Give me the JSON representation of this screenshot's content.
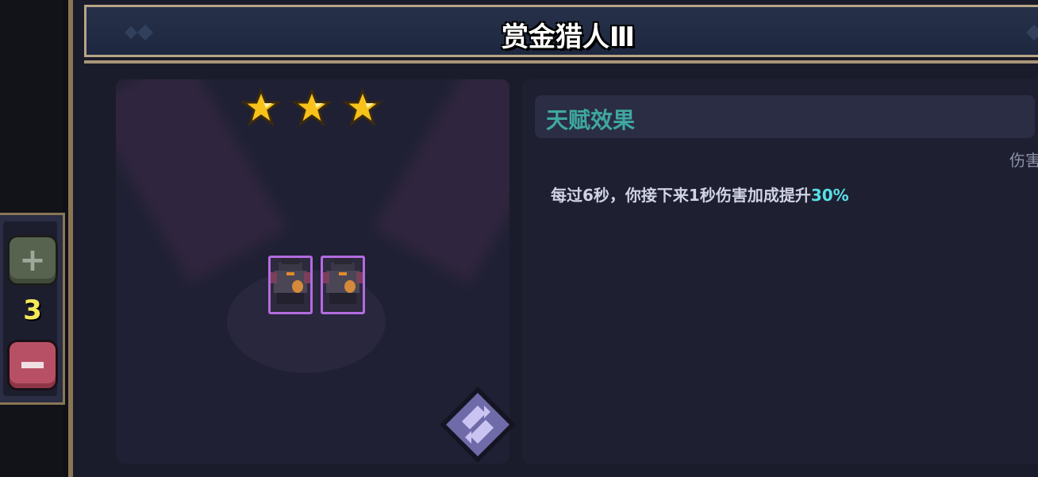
{
  "header": {
    "title": "赏金猎人Ⅲ"
  },
  "stepper": {
    "quantity": "3",
    "plus_icon": "plus-icon",
    "minus_icon": "minus-icon"
  },
  "hero": {
    "stars": 3,
    "max_stars": 3,
    "unit_count": 2
  },
  "talent": {
    "section_title": "天赋效果",
    "tag": "伤害",
    "description_prefix": "每过6秒，你接下来1秒伤害加成提升",
    "description_value": "30%"
  },
  "colors": {
    "accent_teal": "#3fa7a0",
    "highlight_cyan": "#58e0e6",
    "star_gold": "#f7c21a",
    "card_border_purple": "#b36be0"
  },
  "swap_button": {
    "icon": "swap-arrows-icon"
  }
}
